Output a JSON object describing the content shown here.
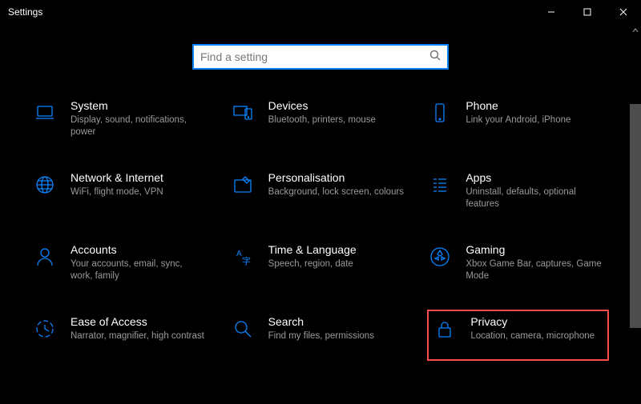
{
  "window": {
    "title": "Settings"
  },
  "search": {
    "placeholder": "Find a setting"
  },
  "tiles": [
    {
      "id": "system",
      "icon": "laptop-icon",
      "title": "System",
      "sub": "Display, sound, notifications, power"
    },
    {
      "id": "devices",
      "icon": "devices-icon",
      "title": "Devices",
      "sub": "Bluetooth, printers, mouse"
    },
    {
      "id": "phone",
      "icon": "phone-icon",
      "title": "Phone",
      "sub": "Link your Android, iPhone"
    },
    {
      "id": "network",
      "icon": "globe-icon",
      "title": "Network & Internet",
      "sub": "WiFi, flight mode, VPN"
    },
    {
      "id": "personalisation",
      "icon": "paint-icon",
      "title": "Personalisation",
      "sub": "Background, lock screen, colours"
    },
    {
      "id": "apps",
      "icon": "apps-icon",
      "title": "Apps",
      "sub": "Uninstall, defaults, optional features"
    },
    {
      "id": "accounts",
      "icon": "person-icon",
      "title": "Accounts",
      "sub": "Your accounts, email, sync, work, family"
    },
    {
      "id": "timelang",
      "icon": "time-language-icon",
      "title": "Time & Language",
      "sub": "Speech, region, date"
    },
    {
      "id": "gaming",
      "icon": "gaming-icon",
      "title": "Gaming",
      "sub": "Xbox Game Bar, captures, Game Mode"
    },
    {
      "id": "ease",
      "icon": "ease-of-access-icon",
      "title": "Ease of Access",
      "sub": "Narrator, magnifier, high contrast"
    },
    {
      "id": "search",
      "icon": "search-category-icon",
      "title": "Search",
      "sub": "Find my files, permissions"
    },
    {
      "id": "privacy",
      "icon": "lock-icon",
      "title": "Privacy",
      "sub": "Location, camera, microphone",
      "highlight": true
    }
  ]
}
